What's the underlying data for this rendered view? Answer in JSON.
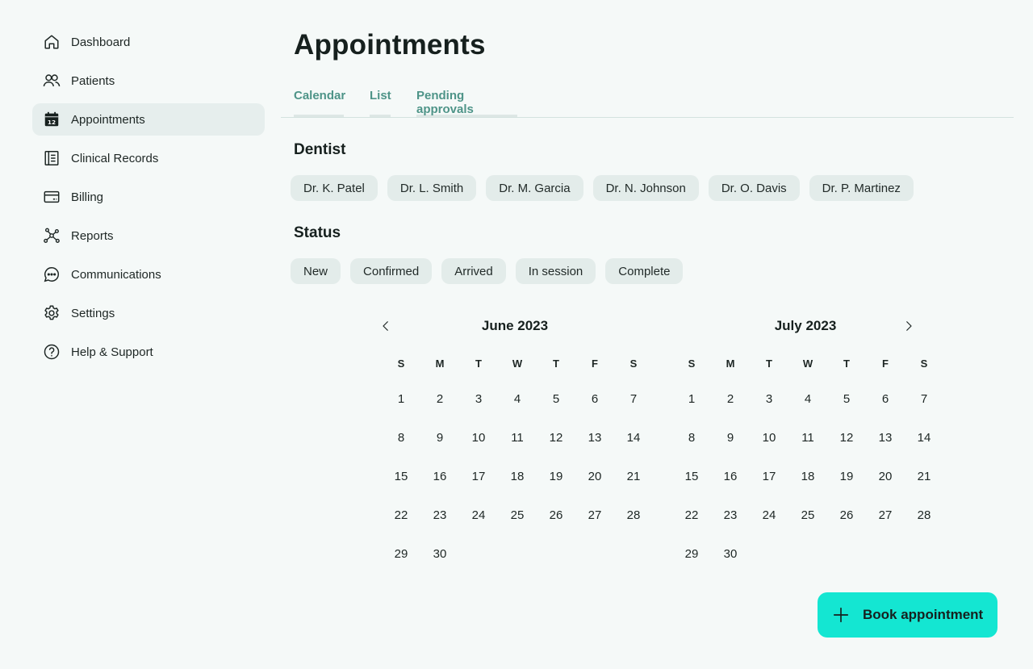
{
  "sidebar": {
    "items": [
      {
        "label": "Dashboard",
        "icon": "home-icon"
      },
      {
        "label": "Patients",
        "icon": "users-icon"
      },
      {
        "label": "Appointments",
        "icon": "calendar-icon",
        "active": true,
        "badge": "12"
      },
      {
        "label": "Clinical Records",
        "icon": "records-icon"
      },
      {
        "label": "Billing",
        "icon": "card-icon"
      },
      {
        "label": "Reports",
        "icon": "network-icon"
      },
      {
        "label": "Communications",
        "icon": "chat-icon"
      },
      {
        "label": "Settings",
        "icon": "gear-icon"
      },
      {
        "label": "Help & Support",
        "icon": "help-icon"
      }
    ]
  },
  "main": {
    "title": "Appointments",
    "tabs": [
      {
        "label": "Calendar"
      },
      {
        "label": "List"
      },
      {
        "label": "Pending approvals"
      }
    ],
    "dentist_filter": {
      "title": "Dentist",
      "options": [
        "Dr. K. Patel",
        "Dr. L. Smith",
        "Dr. M. Garcia",
        "Dr. N. Johnson",
        "Dr. O. Davis",
        "Dr. P. Martinez"
      ]
    },
    "status_filter": {
      "title": "Status",
      "options": [
        "New",
        "Confirmed",
        "Arrived",
        "In session",
        "Complete"
      ]
    }
  },
  "calendar": {
    "weekdays": [
      "S",
      "M",
      "T",
      "W",
      "T",
      "F",
      "S"
    ],
    "months": [
      {
        "title": "June 2023",
        "days": 30
      },
      {
        "title": "July 2023",
        "days": 30
      }
    ]
  },
  "actions": {
    "book_label": "Book appointment"
  },
  "colors": {
    "accent": "#14e6d2",
    "tab_text": "#4e9488",
    "chip_bg": "#e3ecea",
    "active_nav_bg": "#e6eeed",
    "background": "#f5f9f8"
  }
}
